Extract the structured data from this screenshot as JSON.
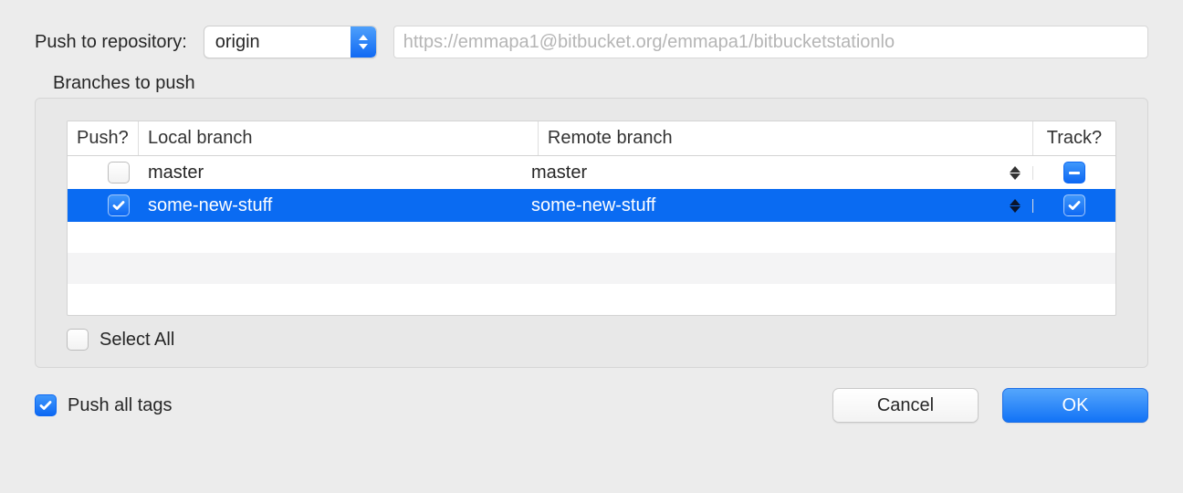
{
  "top": {
    "label": "Push to repository:",
    "remote_selected": "origin",
    "url": "https://emmapa1@bitbucket.org/emmapa1/bitbucketstationlo"
  },
  "group": {
    "title": "Branches to push",
    "columns": {
      "push": "Push?",
      "local": "Local branch",
      "remote": "Remote branch",
      "track": "Track?"
    },
    "rows": [
      {
        "push_checked": false,
        "local": "master",
        "remote": "master",
        "track_state": "mixed",
        "selected": false
      },
      {
        "push_checked": true,
        "local": "some-new-stuff",
        "remote": "some-new-stuff",
        "track_state": "checked",
        "selected": true
      }
    ],
    "select_all": {
      "label": "Select All",
      "checked": false
    }
  },
  "push_tags": {
    "label": "Push all tags",
    "checked": true
  },
  "buttons": {
    "cancel": "Cancel",
    "ok": "OK"
  }
}
